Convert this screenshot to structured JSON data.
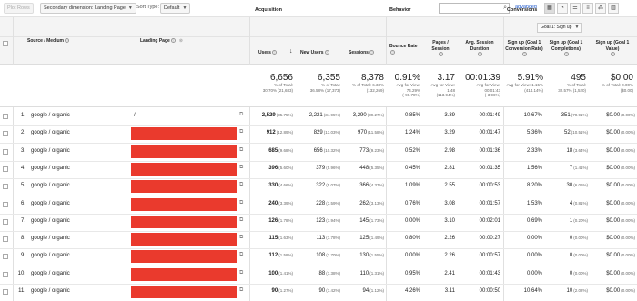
{
  "toolbar": {
    "plot_rows": "Plot Rows",
    "secondary_dimension": "Secondary dimension: Landing Page",
    "sort_type_label": "Sort Type:",
    "sort_type": "Default",
    "advanced": "advanced"
  },
  "groups": {
    "acquisition": "Acquisition",
    "behavior": "Behavior",
    "conversions": "Conversions",
    "goal_selector": "Goal 1: Sign up"
  },
  "columns": {
    "source": "Source / Medium",
    "landing": "Landing Page",
    "users": "Users",
    "new_users": "New Users",
    "sessions": "Sessions",
    "bounce": "Bounce Rate",
    "pages": "Pages / Session",
    "duration": "Avg. Session Duration",
    "conv_rate": "Sign up (Goal 1 Conversion Rate)",
    "completions": "Sign up (Goal 1 Completions)",
    "value": "Sign up (Goal 1 Value)"
  },
  "totals": {
    "users": {
      "big": "6,656",
      "l1": "% of Total:",
      "l2": "30.70% (21,683)"
    },
    "new_users": {
      "big": "6,355",
      "l1": "% of Total:",
      "l2": "36.58% (17,373)"
    },
    "sessions": {
      "big": "8,378",
      "l1": "% of Total: 6.33%",
      "l2": "(132,269)"
    },
    "bounce": {
      "big": "0.91%",
      "l1": "Avg for View:",
      "l2": "74.29%",
      "l3": "(-98.78%)"
    },
    "pages": {
      "big": "3.17",
      "l1": "Avg for View: 1.48",
      "l2": "(113.94%)"
    },
    "duration": {
      "big": "00:01:39",
      "l1": "Avg for View:",
      "l2": "00:01:43",
      "l3": "(-3.96%)"
    },
    "conv_rate": {
      "big": "5.91%",
      "l1": "Avg for View: 1.15%",
      "l2": "(414.14%)"
    },
    "completions": {
      "big": "495",
      "l1": "% of Total:",
      "l2": "32.57% (1,520)"
    },
    "value": {
      "big": "$0.00",
      "l1": "% of Total: 0.00%",
      "l2": "($0.00)"
    }
  },
  "rows": [
    {
      "idx": "1.",
      "src": "google / organic",
      "lp": "/",
      "users": "2,529",
      "users_pct": "(35.75%)",
      "new": "2,221",
      "new_pct": "(34.95%)",
      "sess": "3,290",
      "sess_pct": "(39.27%)",
      "bounce": "0.85%",
      "pages": "3.39",
      "dur": "00:01:49",
      "conv": "10.67%",
      "comp": "351",
      "comp_pct": "(70.91%)",
      "val": "$0.00",
      "val_pct": "(0.00%)"
    },
    {
      "idx": "2.",
      "src": "google / organic",
      "lp": "",
      "users": "912",
      "users_pct": "(12.89%)",
      "new": "829",
      "new_pct": "(13.03%)",
      "sess": "970",
      "sess_pct": "(11.58%)",
      "bounce": "1.24%",
      "pages": "3.29",
      "dur": "00:01:47",
      "conv": "5.36%",
      "comp": "52",
      "comp_pct": "(10.51%)",
      "val": "$0.00",
      "val_pct": "(0.00%)"
    },
    {
      "idx": "3.",
      "src": "google / organic",
      "lp": "",
      "users": "685",
      "users_pct": "(9.68%)",
      "new": "656",
      "new_pct": "(10.32%)",
      "sess": "773",
      "sess_pct": "(9.23%)",
      "bounce": "0.52%",
      "pages": "2.98",
      "dur": "00:01:36",
      "conv": "2.33%",
      "comp": "18",
      "comp_pct": "(3.64%)",
      "val": "$0.00",
      "val_pct": "(0.00%)"
    },
    {
      "idx": "4.",
      "src": "google / organic",
      "lp": "",
      "users": "396",
      "users_pct": "(5.60%)",
      "new": "379",
      "new_pct": "(5.96%)",
      "sess": "448",
      "sess_pct": "(5.35%)",
      "bounce": "0.45%",
      "pages": "2.81",
      "dur": "00:01:35",
      "conv": "1.56%",
      "comp": "7",
      "comp_pct": "(1.41%)",
      "val": "$0.00",
      "val_pct": "(0.00%)"
    },
    {
      "idx": "5.",
      "src": "google / organic",
      "lp": "",
      "users": "330",
      "users_pct": "(4.66%)",
      "new": "322",
      "new_pct": "(5.07%)",
      "sess": "366",
      "sess_pct": "(4.37%)",
      "bounce": "1.09%",
      "pages": "2.55",
      "dur": "00:00:53",
      "conv": "8.20%",
      "comp": "30",
      "comp_pct": "(6.06%)",
      "val": "$0.00",
      "val_pct": "(0.00%)"
    },
    {
      "idx": "6.",
      "src": "google / organic",
      "lp": "",
      "users": "240",
      "users_pct": "(3.39%)",
      "new": "228",
      "new_pct": "(3.59%)",
      "sess": "262",
      "sess_pct": "(3.13%)",
      "bounce": "0.76%",
      "pages": "3.08",
      "dur": "00:01:57",
      "conv": "1.53%",
      "comp": "4",
      "comp_pct": "(0.81%)",
      "val": "$0.00",
      "val_pct": "(0.00%)"
    },
    {
      "idx": "7.",
      "src": "google / organic",
      "lp": "",
      "users": "126",
      "users_pct": "(1.78%)",
      "new": "123",
      "new_pct": "(1.94%)",
      "sess": "145",
      "sess_pct": "(1.73%)",
      "bounce": "0.00%",
      "pages": "3.10",
      "dur": "00:02:01",
      "conv": "0.69%",
      "comp": "1",
      "comp_pct": "(0.20%)",
      "val": "$0.00",
      "val_pct": "(0.00%)"
    },
    {
      "idx": "8.",
      "src": "google / organic",
      "lp": "",
      "users": "115",
      "users_pct": "(1.63%)",
      "new": "113",
      "new_pct": "(1.78%)",
      "sess": "125",
      "sess_pct": "(1.49%)",
      "bounce": "0.80%",
      "pages": "2.26",
      "dur": "00:00:27",
      "conv": "0.00%",
      "comp": "0",
      "comp_pct": "(0.00%)",
      "val": "$0.00",
      "val_pct": "(0.00%)"
    },
    {
      "idx": "9.",
      "src": "google / organic",
      "lp": "",
      "users": "112",
      "users_pct": "(1.58%)",
      "new": "108",
      "new_pct": "(1.70%)",
      "sess": "130",
      "sess_pct": "(1.55%)",
      "bounce": "0.00%",
      "pages": "2.26",
      "dur": "00:00:57",
      "conv": "0.00%",
      "comp": "0",
      "comp_pct": "(0.00%)",
      "val": "$0.00",
      "val_pct": "(0.00%)"
    },
    {
      "idx": "10.",
      "src": "google / organic",
      "lp": "",
      "users": "100",
      "users_pct": "(1.41%)",
      "new": "88",
      "new_pct": "(1.38%)",
      "sess": "110",
      "sess_pct": "(1.31%)",
      "bounce": "0.95%",
      "pages": "2.41",
      "dur": "00:01:43",
      "conv": "0.00%",
      "comp": "0",
      "comp_pct": "(0.00%)",
      "val": "$0.00",
      "val_pct": "(0.00%)"
    },
    {
      "idx": "11.",
      "src": "google / organic",
      "lp": "",
      "users": "90",
      "users_pct": "(1.27%)",
      "new": "90",
      "new_pct": "(1.42%)",
      "sess": "94",
      "sess_pct": "(1.12%)",
      "bounce": "4.26%",
      "pages": "3.11",
      "dur": "00:00:50",
      "conv": "10.64%",
      "comp": "10",
      "comp_pct": "(2.02%)",
      "val": "$0.00",
      "val_pct": "(0.00%)"
    }
  ]
}
